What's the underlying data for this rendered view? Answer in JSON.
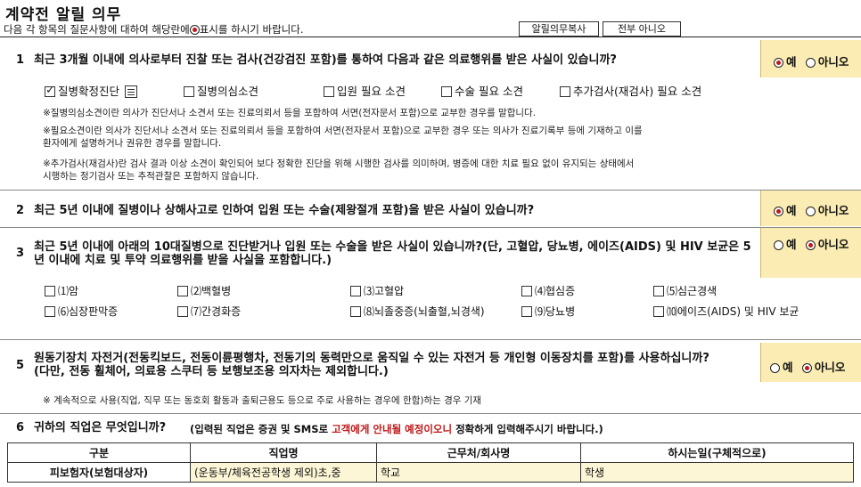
{
  "header": {
    "title": "계약전 알릴 의무",
    "intro_before": "다음 각 항목의 질문사항에 대하여 해당란에",
    "intro_after": "표시를 하시기 바랍니다.",
    "copy_button": "알릴의무복사",
    "all_no_button": "전부 아니오"
  },
  "labels": {
    "yes": "예",
    "no": "아니오"
  },
  "q1": {
    "num": "1",
    "text": "최근 3개월 이내에 의사로부터 진찰 또는 검사(건강검진 포함)를 통하여 다음과 같은 의료행위를 받은 사실이 있습니까?",
    "answer": "yes",
    "options": [
      {
        "label": "질병확정진단",
        "checked": true
      },
      {
        "label": "질병의심소견",
        "checked": false
      },
      {
        "label": "입원 필요 소견",
        "checked": false
      },
      {
        "label": "수술 필요 소견",
        "checked": false
      },
      {
        "label": "추가검사(재검사) 필요 소견",
        "checked": false
      }
    ],
    "notes": [
      "※질병의심소견이란 의사가 진단서나 소견서 또는 진료의뢰서 등을 포함하여 서면(전자문서 포함)으로 교부한 경우를 말합니다.",
      "※필요소견이란 의사가 진단서나 소견서 또는 진료의뢰서 등을 포함하여 서면(전자문서 포함)으로 교부한 경우 또는 의사가 진료기록부 등에 기재하고 이를",
      "환자에게 설명하거나 권유한 경우를 말합니다.",
      "※추가검사(재검사)란 검사 결과 이상 소견이 확인되어 보다 정확한 진단을 위해 시행한 검사를 의미하며, 병증에 대한 치료 필요 없이 유지되는 상태에서",
      "시행하는 정기검사 또는 추적관찰은 포함하지 않습니다."
    ]
  },
  "q2": {
    "num": "2",
    "text": "최근 5년 이내에 질병이나 상해사고로 인하여 입원 또는 수술(제왕절개 포함)을 받은 사실이 있습니까?",
    "answer": "yes"
  },
  "q3": {
    "num": "3",
    "text_line1": "최근 5년 이내에 아래의 10대질병으로 진단받거나 입원 또는 수술을 받은 사실이 있습니까?(단, 고혈압, 당뇨병, 에이즈(AIDS) 및 HIV 보균은 5",
    "text_line2": "년 이내에 치료 및 투약 의료행위를 받을 사실을 포함합니다.)",
    "answer": "no",
    "diseases": [
      "⑴암",
      "⑵백혈병",
      "⑶고혈압",
      "⑷협심증",
      "⑸심근경색",
      "⑹심장판막증",
      "⑺간경화증",
      "⑻뇌졸중증(뇌출혈,뇌경색)",
      "⑼당뇨병",
      "⑽에이즈(AIDS) 및 HIV 보균"
    ]
  },
  "q5": {
    "num": "5",
    "text_line1": "원동기장치 자전거(전동킥보드, 전동이륜평행차, 전동기의 동력만으로 움직일 수 있는 자전거 등 개인형 이동장치를 포함)를 사용하십니까?",
    "text_line2": "(다만, 전동 휠체어, 의료용 스쿠터 등 보행보조용 의자차는 제외합니다.)",
    "answer": "no",
    "note": "※ 계속적으로 사용(직업, 직무 또는 동호회 활동과 출퇴근용도 등으로 주로 사용하는 경우에 한함)하는 경우 기재"
  },
  "q6": {
    "num": "6",
    "text": "귀하의 직업은 무엇입니까?",
    "notice_before": "(입력된 직업은 증권 및 SMS로 ",
    "notice_highlight": "고객에게 안내될 예정이오니",
    "notice_after": " 정확하게 입력해주시기 바랍니다.)",
    "columns": [
      "구분",
      "직업명",
      "근무처/회사명",
      "하시는일(구체적으로)"
    ],
    "row": {
      "label": "피보험자(보험대상자)",
      "job": "(운동부/체육전공학생 제외)초,중",
      "workplace": "학교",
      "duty": "학생"
    }
  }
}
